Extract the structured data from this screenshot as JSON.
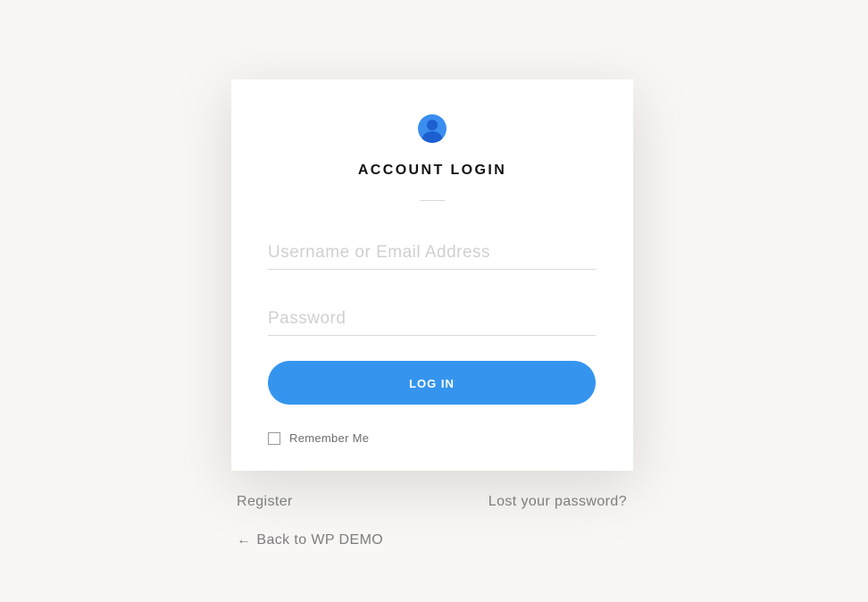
{
  "colors": {
    "background": "#f8f7f6",
    "card": "#ffffff",
    "accent": "#3595ee",
    "avatar": "#3a8ef0"
  },
  "login": {
    "avatar_icon": "user-avatar-icon",
    "title": "ACCOUNT LOGIN",
    "username_placeholder": "Username or Email Address",
    "password_placeholder": "Password",
    "submit_label": "LOG IN",
    "remember_label": "Remember Me",
    "remember_checked": false
  },
  "links": {
    "register": "Register",
    "lost_password": "Lost your password?",
    "back_arrow": "←",
    "back": "Back to WP DEMO"
  }
}
